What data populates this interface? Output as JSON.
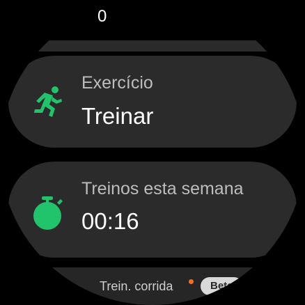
{
  "header": {
    "top_value": "0"
  },
  "cards": [
    {
      "title": "Exercício",
      "value": "Treinar",
      "icon": "running-person-icon",
      "icon_color": "#21c46a"
    },
    {
      "title": "Treinos esta semana",
      "value": "00:16",
      "icon": "stopwatch-icon",
      "icon_color": "#21c46a"
    }
  ],
  "footer": {
    "label": "Trein. corrida",
    "badge": "Beta",
    "dot_color": "#ff6d1f"
  },
  "colors": {
    "background": "#000000",
    "card": "#2b2b2b",
    "accent_green": "#21c46a"
  }
}
